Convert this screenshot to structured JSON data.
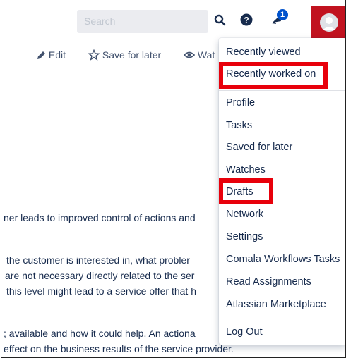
{
  "header": {
    "search_placeholder": "Search",
    "notification_count": "1",
    "icons": [
      "search-icon",
      "help-icon",
      "notification-icon",
      "avatar"
    ]
  },
  "toolbar": {
    "edit": "Edit",
    "save_for_later": "Save for later",
    "watch": "Wat"
  },
  "body_lines": [
    "ner leads to improved control of actions and",
    " the customer is interested in, what probler",
    "are not necessary directly related to the ser",
    "this level might lead to a service offer that h",
    "; available and how it could help. An actiona",
    "effect on the business results of the service provider."
  ],
  "menu": {
    "group1": [
      "Recently viewed",
      "Recently worked on"
    ],
    "group2": [
      "Profile",
      "Tasks",
      "Saved for later",
      "Watches",
      "Drafts",
      "Network",
      "Settings",
      "Comala Workflows Tasks",
      "Read Assignments",
      "Atlassian Marketplace"
    ],
    "group3": [
      "Log Out"
    ]
  },
  "colors": {
    "highlight": "#e8000b",
    "avatar_bg": "#c1121f",
    "badge": "#0052cc"
  }
}
